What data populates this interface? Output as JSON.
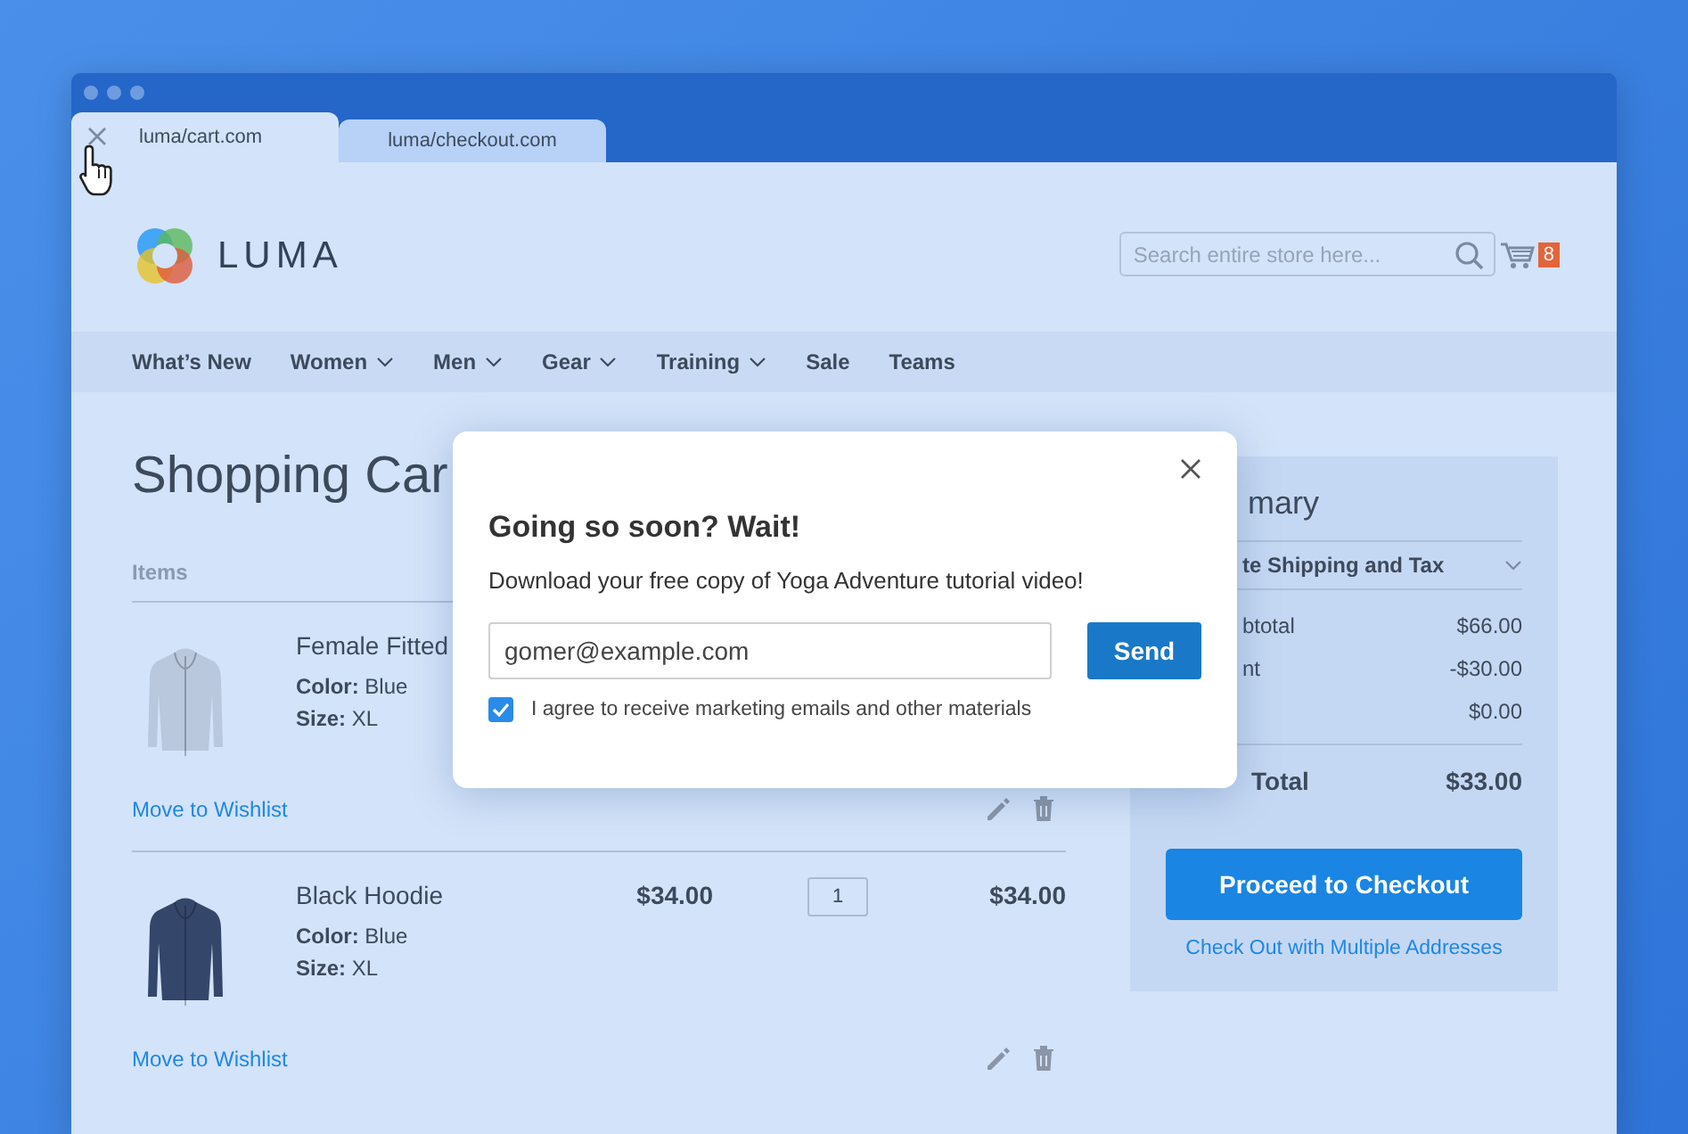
{
  "browser": {
    "tabs": [
      {
        "label": "luma/cart.com",
        "selected": true
      },
      {
        "label": "luma/checkout.com",
        "selected": false
      }
    ]
  },
  "header": {
    "logo": "LUMA",
    "search": {
      "placeholder": "Search entire store here..."
    },
    "cart_count": "8"
  },
  "nav": [
    {
      "label": "What’s New",
      "has_menu": false
    },
    {
      "label": "Women",
      "has_menu": true
    },
    {
      "label": "Men",
      "has_menu": true
    },
    {
      "label": "Gear",
      "has_menu": true
    },
    {
      "label": "Training",
      "has_menu": true
    },
    {
      "label": "Sale",
      "has_menu": false
    },
    {
      "label": "Teams",
      "has_menu": false
    }
  ],
  "page_title": "Shopping Car",
  "cart": {
    "column": "Items",
    "items": [
      {
        "kind": "light",
        "name": "Female Fitted",
        "color_label": "Color:",
        "color_value": "Blue",
        "size_label": "Size:",
        "size_value": "XL",
        "wishlist": "Move to Wishlist"
      },
      {
        "kind": "dark",
        "name": "Black Hoodie",
        "color_label": "Color:",
        "color_value": "Blue",
        "size_label": "Size:",
        "size_value": "XL",
        "price": "$34.00",
        "qty": "1",
        "subtotal": "$34.00",
        "wishlist": "Move to Wishlist"
      }
    ]
  },
  "summary": {
    "title": "mary",
    "shipping_toggle": "te Shipping and Tax",
    "rows": [
      {
        "label": "btotal",
        "value": "$66.00"
      },
      {
        "label": "nt",
        "value": "-$30.00"
      },
      {
        "value": "$0.00"
      }
    ],
    "total": {
      "label": "Total",
      "value": "$33.00"
    },
    "checkout_button": "Proceed to Checkout",
    "multi_link": "Check Out with Multiple Addresses"
  },
  "modal": {
    "title": "Going so soon? Wait!",
    "text": "Download your free copy of Yoga Adventure tutorial video!",
    "email": "gomer@example.com",
    "send": "Send",
    "consent": {
      "label": "I agree to receive marketing emails and other materials",
      "checked": true
    }
  }
}
